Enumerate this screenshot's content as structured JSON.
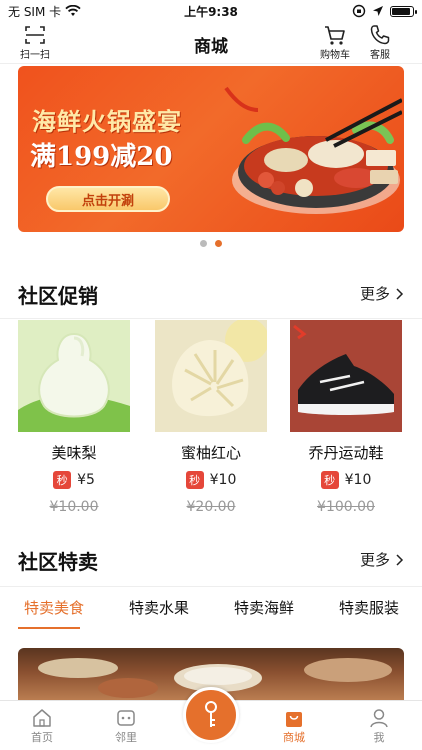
{
  "status": {
    "carrier": "无 SIM 卡",
    "time": "上午9:38"
  },
  "nav": {
    "title": "商城",
    "scan_label": "扫一扫",
    "cart_label": "购物车",
    "service_label": "客服"
  },
  "banner": {
    "title": "海鲜火锅盛宴",
    "subtitle": "满199减20",
    "button_label": "点击开涮"
  },
  "promo_section": {
    "title": "社区促销",
    "more_label": "更多",
    "products": [
      {
        "name": "美味梨",
        "badge": "秒",
        "price": "¥5",
        "old_price": "¥10.00"
      },
      {
        "name": "蜜柚红心",
        "badge": "秒",
        "price": "¥10",
        "old_price": "¥20.00"
      },
      {
        "name": "乔丹运动鞋",
        "badge": "秒",
        "price": "¥10",
        "old_price": "¥100.00"
      }
    ]
  },
  "special_section": {
    "title": "社区特卖",
    "more_label": "更多",
    "tabs": [
      {
        "label": "特卖美食",
        "active": true
      },
      {
        "label": "特卖水果",
        "active": false
      },
      {
        "label": "特卖海鲜",
        "active": false
      },
      {
        "label": "特卖服装",
        "active": false
      }
    ]
  },
  "tab_bar": {
    "items": [
      {
        "label": "首页",
        "icon": "home-icon"
      },
      {
        "label": "邻里",
        "icon": "neighbor-icon"
      },
      {
        "label": "",
        "icon": "key-icon"
      },
      {
        "label": "商城",
        "icon": "shop-bag-icon",
        "active": true
      },
      {
        "label": "我",
        "icon": "profile-icon"
      }
    ]
  },
  "colors": {
    "accent": "#e5702c",
    "badge": "#e5473a",
    "banner": "#f0521d"
  }
}
